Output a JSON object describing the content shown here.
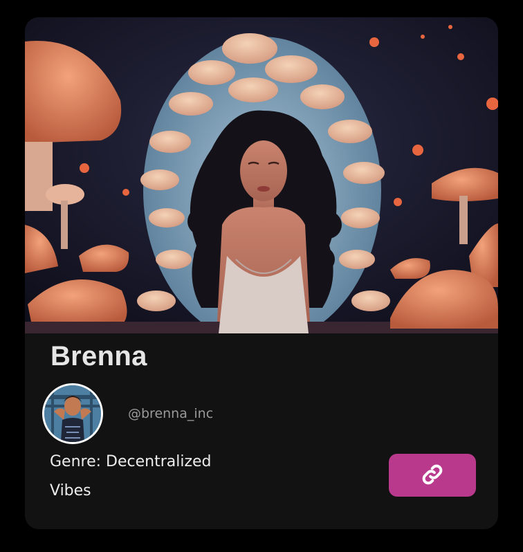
{
  "profile": {
    "name": "Brenna",
    "handle": "@brenna_inc",
    "genre": "Genre: Decentralized Vibes"
  },
  "icons": {
    "link": "link-icon"
  },
  "colors": {
    "card_background": "#121212",
    "page_background": "#000000",
    "link_button": "#b93a8c",
    "name_text": "#e6e6e6",
    "handle_text": "#9a9a9a"
  }
}
